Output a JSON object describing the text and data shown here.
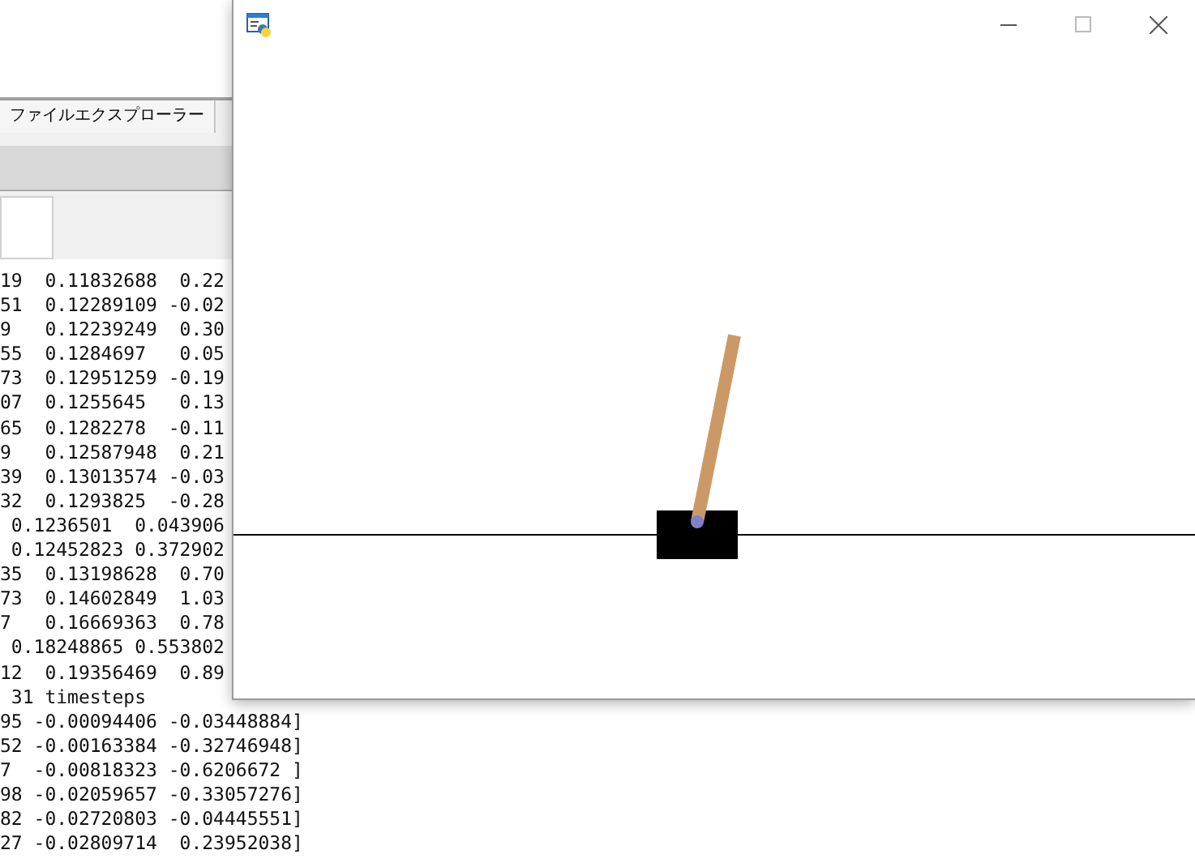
{
  "background_app": {
    "tabs": [
      {
        "label": "ファイルエクスプローラー",
        "selected": true
      }
    ]
  },
  "console": {
    "lines": [
      "19  0.11832688  0.22",
      "51  0.12289109 -0.02",
      "9   0.12239249  0.30",
      "55  0.1284697   0.05",
      "73  0.12951259 -0.19",
      "07  0.1255645   0.13",
      "65  0.1282278  -0.11",
      "9   0.12587948  0.21",
      "39  0.13013574 -0.03",
      "32  0.1293825  -0.28",
      " 0.1236501  0.043906",
      " 0.12452823 0.372902",
      "35  0.13198628  0.70",
      "73  0.14602849  1.03",
      "7   0.16669363  0.78",
      " 0.18248865 0.553802",
      "12  0.19356469  0.89",
      " 31 timesteps",
      "95 -0.00094406 -0.03448884]",
      "52 -0.00163384 -0.32746948]",
      "7  -0.00818323 -0.6206672 ]",
      "98 -0.02059657 -0.33057276]",
      "82 -0.02720803 -0.04445551]",
      "27 -0.02809714  0.23952038]"
    ]
  }
}
